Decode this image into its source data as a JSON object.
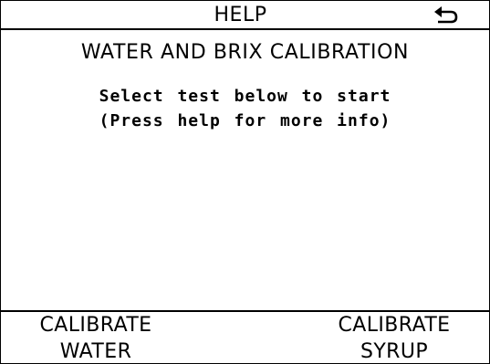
{
  "header": {
    "help_label": "HELP",
    "back_icon": "return-arrow-icon"
  },
  "main": {
    "title": "WATER AND BRIX CALIBRATION",
    "line1": "Select test below to start",
    "line2": "(Press help for more info)"
  },
  "softkeys": {
    "left": {
      "line1": "CALIBRATE",
      "line2": "WATER"
    },
    "right": {
      "line1": "CALIBRATE",
      "line2": "SYRUP"
    }
  }
}
